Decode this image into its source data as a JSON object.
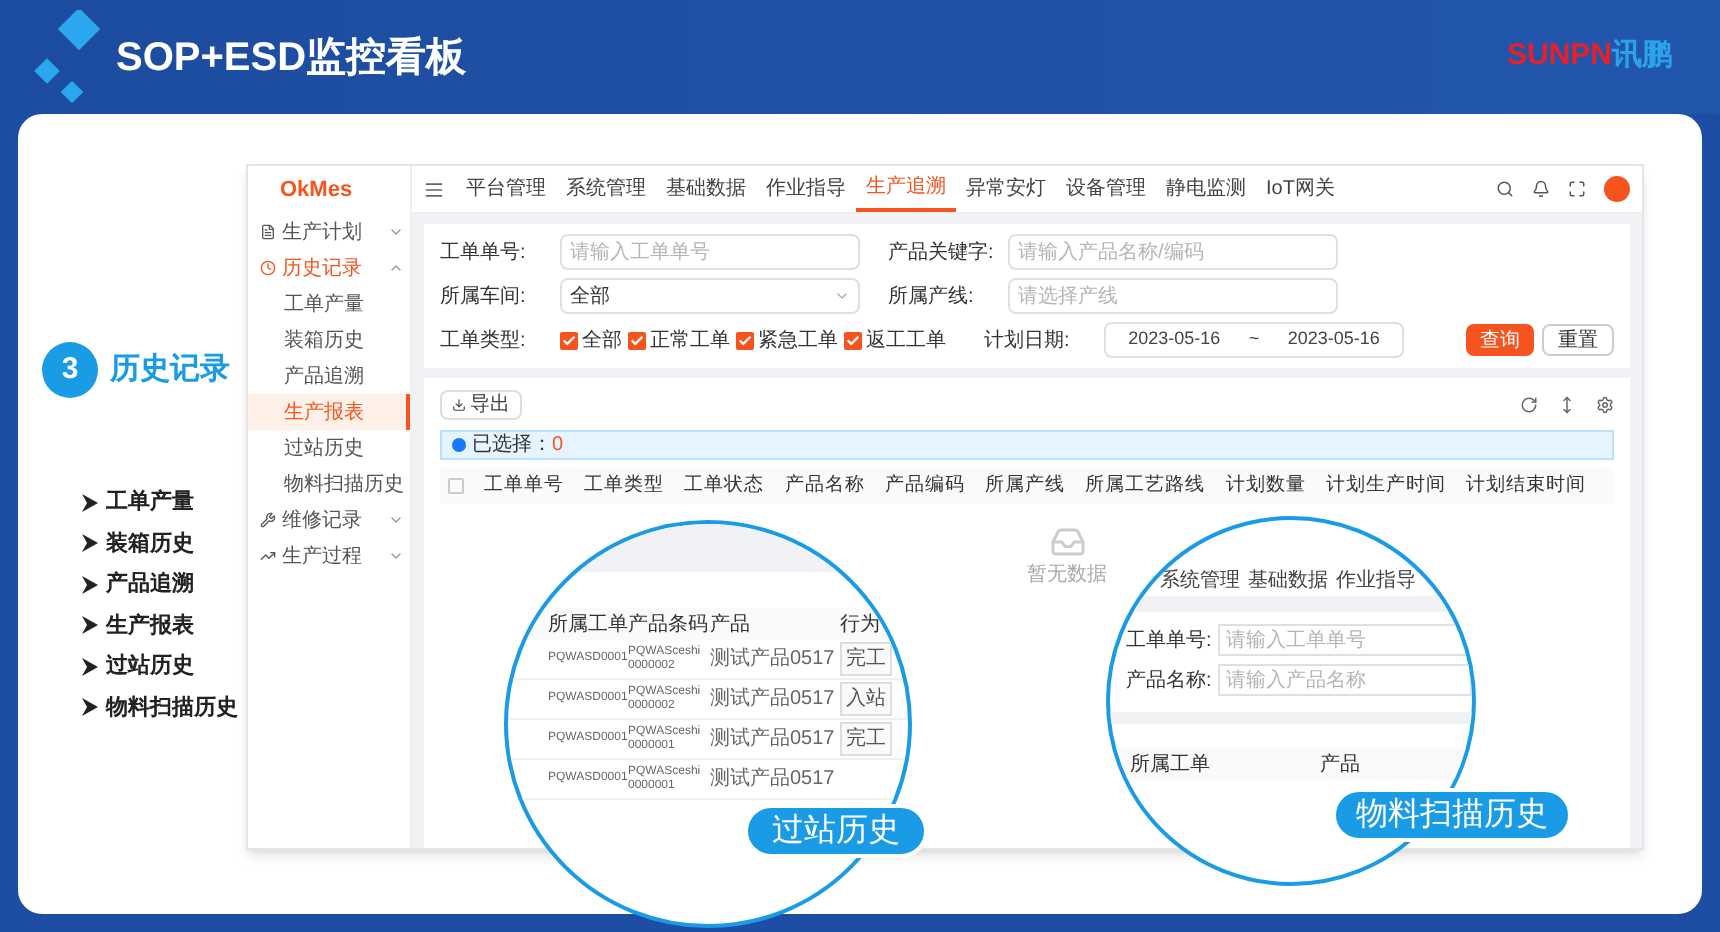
{
  "header": {
    "title": "SOP+ESD监控看板",
    "logo_latin": "SUNPN",
    "logo_cn": "讯鹏"
  },
  "section": {
    "number": "3",
    "title": "历史记录",
    "items": [
      "工单产量",
      "装箱历史",
      "产品追溯",
      "生产报表",
      "过站历史",
      "物料扫描历史"
    ]
  },
  "app": {
    "brand": "OkMes",
    "menu": [
      {
        "label": "生产计划",
        "expanded": false
      },
      {
        "label": "历史记录",
        "expanded": true,
        "children": [
          {
            "label": "工单产量",
            "selected": false
          },
          {
            "label": "装箱历史",
            "selected": false
          },
          {
            "label": "产品追溯",
            "selected": false
          },
          {
            "label": "生产报表",
            "selected": true
          },
          {
            "label": "过站历史",
            "selected": false
          },
          {
            "label": "物料扫描历史",
            "selected": false
          }
        ]
      },
      {
        "label": "维修记录",
        "expanded": false
      },
      {
        "label": "生产过程",
        "expanded": false
      }
    ],
    "tabs": [
      {
        "label": "平台管理",
        "selected": false
      },
      {
        "label": "系统管理",
        "selected": false
      },
      {
        "label": "基础数据",
        "selected": false
      },
      {
        "label": "作业指导",
        "selected": false
      },
      {
        "label": "生产追溯",
        "selected": true
      },
      {
        "label": "异常安灯",
        "selected": false
      },
      {
        "label": "设备管理",
        "selected": false
      },
      {
        "label": "静电监测",
        "selected": false
      },
      {
        "label": "IoT网关",
        "selected": false
      }
    ],
    "filters": {
      "order": {
        "label": "工单单号:",
        "placeholder": "请输入工单单号"
      },
      "keyword": {
        "label": "产品关键字:",
        "placeholder": "请输入产品名称/编码"
      },
      "workshop": {
        "label": "所属车间:",
        "value": "全部"
      },
      "line": {
        "label": "所属产线:",
        "placeholder": "请选择产线"
      },
      "types_label": "工单类型:",
      "types": [
        {
          "label": "全部",
          "checked": true
        },
        {
          "label": "正常工单",
          "checked": true
        },
        {
          "label": "紧急工单",
          "checked": true
        },
        {
          "label": "返工工单",
          "checked": true
        }
      ],
      "date_label": "计划日期:",
      "date_from": "2023-05-16",
      "date_sep": "~",
      "date_to": "2023-05-16"
    },
    "buttons": {
      "query": "查询",
      "reset": "重置"
    },
    "export": "导出",
    "selection": {
      "label": "已选择：",
      "count": "0"
    },
    "select_all": {
      "checked": false
    },
    "columns": [
      "工单单号",
      "工单类型",
      "工单状态",
      "产品名称",
      "产品编码",
      "所属产线",
      "所属工艺路线",
      "计划数量",
      "计划生产时间",
      "计划结束时间"
    ],
    "empty": "暂无数据"
  },
  "zoom_left": {
    "label": "过站历史",
    "columns": [
      "所属工单",
      "产品条码",
      "产品",
      "行为"
    ],
    "rows": [
      {
        "order": "PQWASD0001",
        "barcode": "PQWASceshi0000002",
        "product": "测试产品0517",
        "action": "完工"
      },
      {
        "order": "PQWASD0001",
        "barcode": "PQWASceshi0000002",
        "product": "测试产品0517",
        "action": "入站"
      },
      {
        "order": "PQWASD0001",
        "barcode": "PQWASceshi0000001",
        "product": "测试产品0517",
        "action": "完工"
      },
      {
        "order": "PQWASD0001",
        "barcode": "PQWASceshi0000001",
        "product": "测试产品0517"
      }
    ]
  },
  "zoom_right": {
    "label": "物料扫描历史",
    "tabs": [
      "系统管理",
      "基础数据",
      "作业指导"
    ],
    "fields": [
      {
        "label": "工单单号:",
        "placeholder": "请输入工单单号"
      },
      {
        "label": "产品名称:",
        "placeholder": "请输入产品名称"
      }
    ],
    "columns": [
      "所属工单",
      "产品"
    ]
  }
}
